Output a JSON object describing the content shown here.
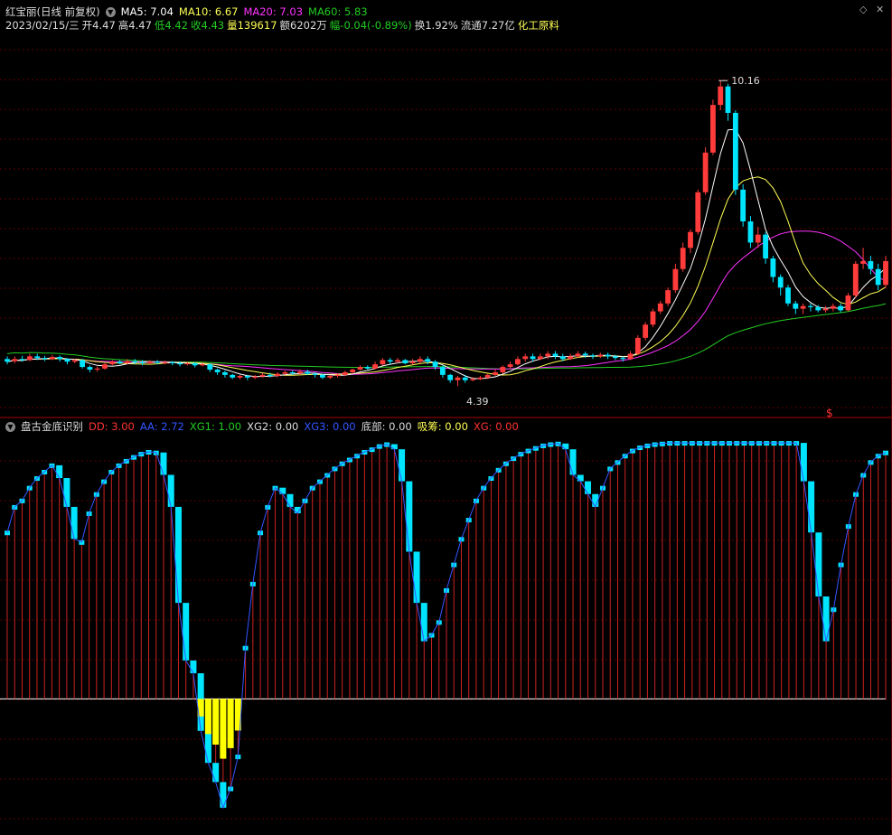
{
  "colors": {
    "up": "#ff3b3b",
    "down": "#00e5ff",
    "ma5": "#ffffff",
    "ma10": "#ffff55",
    "ma20": "#ff33ff",
    "ma60": "#22cc22",
    "yellow": "#ffff00",
    "grid": "#5a0000",
    "axis": "#a00000",
    "stem": "#cc2222"
  },
  "header": {
    "stock_title": "红宝丽(日线 前复权)",
    "ma5": "MA5: 7.04",
    "ma10": "MA10: 6.67",
    "ma20": "MA20: 7.03",
    "ma60": "MA60: 5.83",
    "date": "2023/02/15/三",
    "open": "开4.47",
    "high": "高4.47",
    "low": "低4.42",
    "close": "收4.43",
    "volume": "量139617",
    "amount": "额6202万",
    "change": "幅-0.04(-0.89%)",
    "turnover": "换1.92%",
    "float_cap": "流通7.27亿",
    "sector": "化工原料"
  },
  "indicator": {
    "name": "盘古金底识别",
    "dd": "DD: 3.00",
    "aa": "AA: 2.72",
    "xg1": "XG1: 1.00",
    "xg2": "XG2: 0.00",
    "xg3": "XG3: 0.00",
    "bottom": "底部: 0.00",
    "absorb": "吸筹: 0.00",
    "xg": "XG: 0.00"
  },
  "annotations": {
    "high_price": "10.16",
    "low_price": "4.39",
    "signal": "$"
  },
  "chart_data": [
    {
      "type": "candlestick",
      "candles": [
        [
          4.9,
          4.85,
          4.95,
          4.8
        ],
        [
          4.86,
          4.9,
          4.95,
          4.82
        ],
        [
          4.9,
          4.88,
          4.96,
          4.85
        ],
        [
          4.88,
          4.95,
          5.0,
          4.86
        ],
        [
          4.95,
          4.92,
          5.0,
          4.88
        ],
        [
          4.92,
          4.9,
          4.96,
          4.86
        ],
        [
          4.9,
          4.94,
          4.98,
          4.88
        ],
        [
          4.94,
          4.9,
          4.97,
          4.85
        ],
        [
          4.9,
          4.85,
          4.92,
          4.8
        ],
        [
          4.85,
          4.88,
          4.9,
          4.82
        ],
        [
          4.88,
          4.75,
          4.9,
          4.72
        ],
        [
          4.75,
          4.7,
          4.78,
          4.65
        ],
        [
          4.7,
          4.72,
          4.76,
          4.66
        ],
        [
          4.72,
          4.8,
          4.82,
          4.7
        ],
        [
          4.8,
          4.85,
          4.88,
          4.78
        ],
        [
          4.85,
          4.82,
          4.88,
          4.8
        ],
        [
          4.82,
          4.86,
          4.9,
          4.8
        ],
        [
          4.86,
          4.84,
          4.9,
          4.8
        ],
        [
          4.84,
          4.82,
          4.88,
          4.78
        ],
        [
          4.82,
          4.85,
          4.88,
          4.8
        ],
        [
          4.85,
          4.83,
          4.88,
          4.8
        ],
        [
          4.83,
          4.84,
          4.87,
          4.8
        ],
        [
          4.84,
          4.82,
          4.86,
          4.78
        ],
        [
          4.82,
          4.8,
          4.85,
          4.76
        ],
        [
          4.8,
          4.82,
          4.85,
          4.78
        ],
        [
          4.82,
          4.78,
          4.84,
          4.74
        ],
        [
          4.78,
          4.8,
          4.84,
          4.76
        ],
        [
          4.8,
          4.7,
          4.82,
          4.66
        ],
        [
          4.7,
          4.65,
          4.72,
          4.6
        ],
        [
          4.65,
          4.6,
          4.68,
          4.55
        ],
        [
          4.6,
          4.55,
          4.62,
          4.52
        ],
        [
          4.55,
          4.58,
          4.6,
          4.52
        ],
        [
          4.58,
          4.55,
          4.6,
          4.5
        ],
        [
          4.55,
          4.57,
          4.6,
          4.52
        ],
        [
          4.57,
          4.6,
          4.63,
          4.55
        ],
        [
          4.6,
          4.58,
          4.64,
          4.55
        ],
        [
          4.58,
          4.62,
          4.65,
          4.56
        ],
        [
          4.62,
          4.65,
          4.68,
          4.6
        ],
        [
          4.65,
          4.63,
          4.68,
          4.6
        ],
        [
          4.63,
          4.66,
          4.7,
          4.6
        ],
        [
          4.66,
          4.62,
          4.7,
          4.6
        ],
        [
          4.62,
          4.6,
          4.65,
          4.55
        ],
        [
          4.6,
          4.55,
          4.62,
          4.52
        ],
        [
          4.55,
          4.58,
          4.6,
          4.52
        ],
        [
          4.58,
          4.6,
          4.63,
          4.55
        ],
        [
          4.6,
          4.65,
          4.68,
          4.58
        ],
        [
          4.65,
          4.7,
          4.72,
          4.62
        ],
        [
          4.7,
          4.75,
          4.78,
          4.68
        ],
        [
          4.75,
          4.72,
          4.78,
          4.7
        ],
        [
          4.72,
          4.8,
          4.85,
          4.7
        ],
        [
          4.8,
          4.88,
          4.92,
          4.78
        ],
        [
          4.88,
          4.85,
          4.92,
          4.8
        ],
        [
          4.85,
          4.88,
          4.92,
          4.82
        ],
        [
          4.88,
          4.82,
          4.9,
          4.8
        ],
        [
          4.82,
          4.85,
          4.9,
          4.8
        ],
        [
          4.85,
          4.9,
          4.95,
          4.82
        ],
        [
          4.9,
          4.85,
          4.95,
          4.8
        ],
        [
          4.85,
          4.75,
          4.88,
          4.7
        ],
        [
          4.75,
          4.6,
          4.78,
          4.55
        ],
        [
          4.6,
          4.5,
          4.62,
          4.45
        ],
        [
          4.5,
          4.55,
          4.58,
          4.39
        ],
        [
          4.55,
          4.5,
          4.6,
          4.45
        ],
        [
          4.5,
          4.52,
          4.56,
          4.48
        ],
        [
          4.52,
          4.55,
          4.58,
          4.5
        ],
        [
          4.55,
          4.6,
          4.62,
          4.52
        ],
        [
          4.6,
          4.65,
          4.7,
          4.58
        ],
        [
          4.65,
          4.75,
          4.78,
          4.62
        ],
        [
          4.75,
          4.8,
          4.85,
          4.72
        ],
        [
          4.8,
          4.9,
          4.95,
          4.78
        ],
        [
          4.9,
          4.95,
          5.0,
          4.85
        ],
        [
          4.95,
          4.9,
          5.0,
          4.85
        ],
        [
          4.9,
          4.95,
          5.0,
          4.88
        ],
        [
          4.95,
          5.0,
          5.05,
          4.9
        ],
        [
          5.0,
          4.95,
          5.05,
          4.9
        ],
        [
          4.95,
          4.9,
          5.0,
          4.86
        ],
        [
          4.9,
          4.95,
          5.0,
          4.88
        ],
        [
          4.95,
          5.0,
          5.05,
          4.92
        ],
        [
          5.0,
          4.97,
          5.04,
          4.92
        ],
        [
          4.97,
          4.95,
          5.0,
          4.9
        ],
        [
          4.95,
          4.98,
          5.02,
          4.92
        ],
        [
          4.98,
          4.95,
          5.02,
          4.9
        ],
        [
          4.95,
          4.92,
          4.98,
          4.88
        ],
        [
          4.92,
          4.9,
          4.95,
          4.85
        ],
        [
          4.9,
          5.0,
          5.05,
          4.88
        ],
        [
          5.0,
          5.3,
          5.35,
          4.98
        ],
        [
          5.3,
          5.55,
          5.6,
          5.25
        ],
        [
          5.55,
          5.8,
          5.85,
          5.5
        ],
        [
          5.8,
          5.95,
          6.0,
          5.75
        ],
        [
          5.95,
          6.2,
          6.25,
          5.9
        ],
        [
          6.2,
          6.6,
          6.7,
          6.15
        ],
        [
          6.6,
          7.0,
          7.1,
          6.55
        ],
        [
          7.0,
          7.3,
          7.35,
          6.9
        ],
        [
          7.3,
          8.05,
          8.1,
          7.25
        ],
        [
          8.05,
          8.8,
          8.9,
          8.0
        ],
        [
          8.8,
          9.7,
          9.8,
          8.75
        ],
        [
          9.7,
          10.05,
          10.16,
          9.6
        ],
        [
          10.05,
          9.55,
          10.1,
          9.4
        ],
        [
          9.55,
          8.1,
          9.6,
          8.0
        ],
        [
          8.1,
          7.5,
          8.2,
          7.4
        ],
        [
          7.5,
          7.1,
          7.6,
          7.0
        ],
        [
          7.1,
          7.25,
          7.4,
          7.0
        ],
        [
          7.25,
          6.8,
          7.3,
          6.7
        ],
        [
          6.8,
          6.45,
          6.85,
          6.35
        ],
        [
          6.45,
          6.25,
          6.5,
          6.1
        ],
        [
          6.25,
          5.95,
          6.3,
          5.9
        ],
        [
          5.95,
          5.85,
          6.0,
          5.75
        ],
        [
          5.85,
          5.9,
          5.95,
          5.75
        ],
        [
          5.9,
          5.88,
          5.95,
          5.8
        ],
        [
          5.88,
          5.82,
          5.92,
          5.78
        ],
        [
          5.82,
          5.85,
          5.9,
          5.78
        ],
        [
          5.85,
          5.9,
          5.95,
          5.8
        ],
        [
          5.9,
          5.82,
          5.95,
          5.78
        ],
        [
          5.82,
          6.1,
          6.15,
          5.8
        ],
        [
          6.1,
          6.7,
          6.75,
          6.05
        ],
        [
          6.7,
          6.75,
          7.0,
          6.6
        ],
        [
          6.75,
          6.6,
          6.85,
          6.5
        ],
        [
          6.6,
          6.3,
          6.7,
          6.2
        ],
        [
          6.3,
          6.75,
          6.85,
          6.25
        ]
      ],
      "y_range": [
        4.0,
        11.0
      ],
      "ma5_label": "MA5",
      "ma10_label": "MA10",
      "ma20_label": "MA20",
      "ma60_label": "MA60"
    },
    {
      "type": "bar",
      "values": [
        2.6,
        3.0,
        3.1,
        3.3,
        3.45,
        3.55,
        3.65,
        3.45,
        3.0,
        2.5,
        2.45,
        2.9,
        3.2,
        3.4,
        3.55,
        3.65,
        3.72,
        3.78,
        3.83,
        3.86,
        3.85,
        3.5,
        3.0,
        1.5,
        0.6,
        0.4,
        -0.5,
        -1.0,
        -1.3,
        -1.7,
        -1.4,
        -0.9,
        0.8,
        1.8,
        2.6,
        3.0,
        3.3,
        3.2,
        3.0,
        2.9,
        3.1,
        3.3,
        3.4,
        3.5,
        3.6,
        3.68,
        3.74,
        3.8,
        3.86,
        3.9,
        3.95,
        3.98,
        3.9,
        3.4,
        2.3,
        1.5,
        0.9,
        1.0,
        1.2,
        1.7,
        2.1,
        2.5,
        2.8,
        3.1,
        3.3,
        3.45,
        3.58,
        3.68,
        3.76,
        3.83,
        3.88,
        3.92,
        3.96,
        3.98,
        3.99,
        3.9,
        3.5,
        3.4,
        3.2,
        3.0,
        3.3,
        3.6,
        3.7,
        3.8,
        3.88,
        3.93,
        3.96,
        3.98,
        3.99,
        4.0,
        4.0,
        4.0,
        4.0,
        4.0,
        4.0,
        4.0,
        4.0,
        4.0,
        4.0,
        4.0,
        4.0,
        4.0,
        4.0,
        4.0,
        4.0,
        4.0,
        4.0,
        3.4,
        2.6,
        1.6,
        0.9,
        1.4,
        2.1,
        2.7,
        3.2,
        3.5,
        3.7,
        3.8,
        3.85
      ],
      "y_range": [
        -2.0,
        4.1
      ]
    }
  ]
}
